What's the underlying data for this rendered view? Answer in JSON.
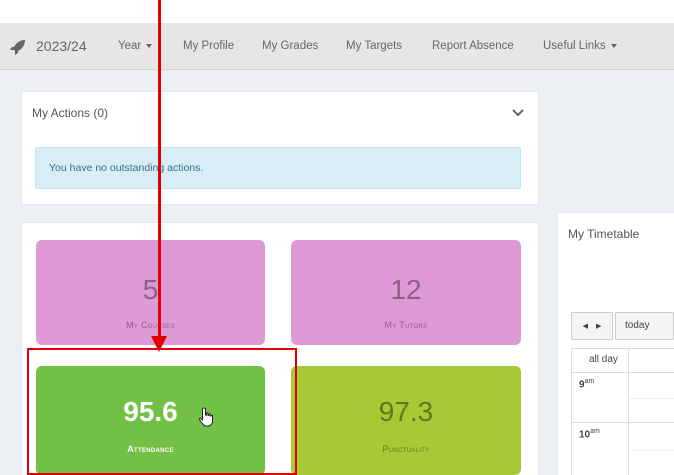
{
  "nav": {
    "year": "2023/24",
    "items": [
      {
        "label": "Year",
        "dropdown": true
      },
      {
        "label": "My Profile"
      },
      {
        "label": "My Grades"
      },
      {
        "label": "My Targets"
      },
      {
        "label": "Report Absence"
      },
      {
        "label": "Useful Links",
        "dropdown": true
      }
    ]
  },
  "actions": {
    "title": "My Actions (0)",
    "message": "You have no outstanding actions."
  },
  "tiles": [
    {
      "value": "5",
      "label": "My Courses",
      "color": "#dd9ad7"
    },
    {
      "value": "12",
      "label": "My Tutors",
      "color": "#dd9ad7"
    },
    {
      "value": "95.6",
      "label": "Attendance",
      "color": "#72c045"
    },
    {
      "value": "97.3",
      "label": "Punctuality",
      "color": "#a6c935"
    }
  ],
  "timetable": {
    "title": "My Timetable",
    "prev_icon": "◀",
    "next_icon": "▶",
    "today_label": "today",
    "all_day_label": "all day",
    "rows": [
      {
        "hour": "9",
        "suffix": "am"
      },
      {
        "hour": "10",
        "suffix": "am"
      }
    ]
  },
  "colors": {
    "annotation": "#e00000",
    "navbar": "#e6e6e6",
    "content_bg": "#ecf0f5"
  }
}
